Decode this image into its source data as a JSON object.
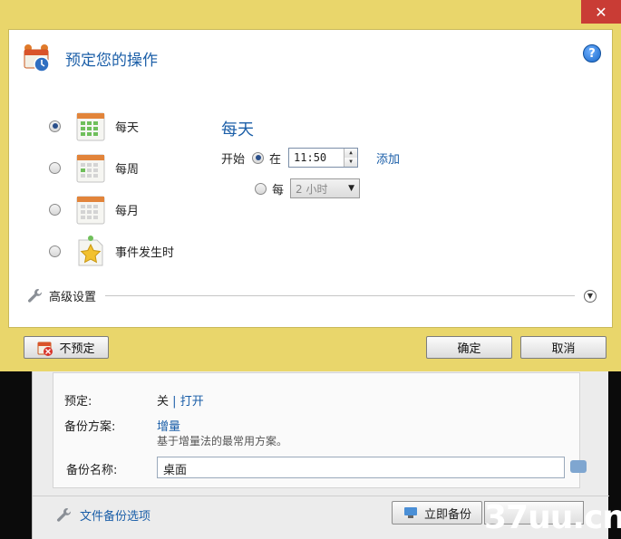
{
  "dialog": {
    "close_glyph": "✕",
    "title": "预定您的操作",
    "help_glyph": "?",
    "options": [
      {
        "label": "每天",
        "selected": true
      },
      {
        "label": "每周",
        "selected": false
      },
      {
        "label": "每月",
        "selected": false
      },
      {
        "label": "事件发生时",
        "selected": false
      }
    ],
    "detail": {
      "title": "每天",
      "start_label": "开始",
      "at_label": "在",
      "time_value": "11:50",
      "add_link": "添加",
      "every_label": "每",
      "interval_value": "2 小时"
    },
    "advanced_label": "高级设置",
    "buttons": {
      "no_schedule": "不预定",
      "ok": "确定",
      "cancel": "取消"
    }
  },
  "background": {
    "schedule_label": "预定:",
    "schedule_off": "关",
    "schedule_sep": "|",
    "schedule_on": "打开",
    "scheme_label": "备份方案:",
    "scheme_value": "增量",
    "scheme_desc": "基于增量法的最常用方案。",
    "name_label": "备份名称:",
    "name_value": "桌面",
    "options_link": "文件备份选项",
    "backup_now": "立即备份"
  },
  "watermark": "37uu.cn",
  "colors": {
    "accent": "#1c5fa8",
    "frame": "#e9d66b",
    "close": "#c93c35"
  }
}
